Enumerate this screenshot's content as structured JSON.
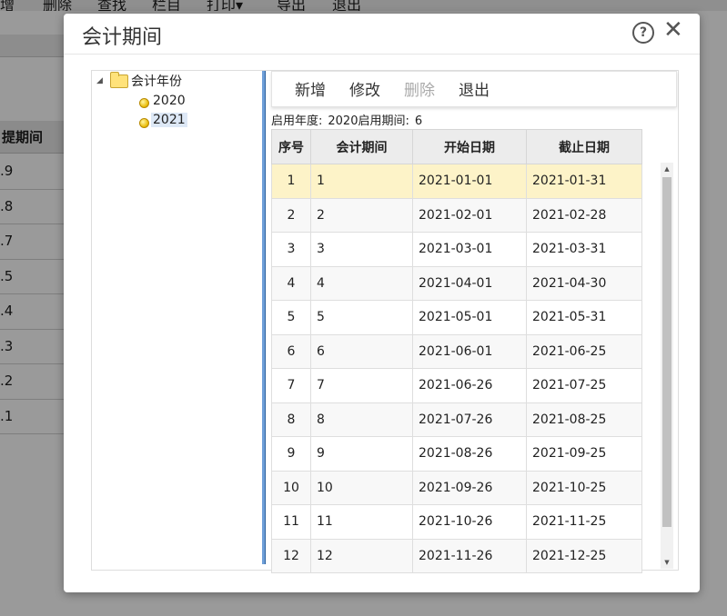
{
  "background": {
    "toolbar_items": [
      "增",
      "删除",
      "查找",
      "栏目",
      "打印▾",
      "导出",
      "退出"
    ],
    "column_header": "提期间",
    "rows": [
      ".9",
      ".8",
      ".7",
      ".5",
      ".4",
      ".3",
      ".2",
      ".1"
    ]
  },
  "dialog": {
    "title": "会计期间",
    "help_symbol": "?",
    "close_symbol": "✕"
  },
  "tree": {
    "root_label": "会计年份",
    "toggle_symbol": "◢",
    "years": [
      "2020",
      "2021"
    ],
    "selected_year": "2021"
  },
  "toolbar": {
    "add_label": "新增",
    "edit_label": "修改",
    "delete_label": "删除",
    "exit_label": "退出"
  },
  "period_info": {
    "start_year_label": "启用年度:",
    "start_year_value": "2020",
    "start_period_label": "启用期间:",
    "start_period_value": "6"
  },
  "table": {
    "headers": [
      "序号",
      "会计期间",
      "开始日期",
      "截止日期"
    ],
    "rows": [
      [
        "1",
        "1",
        "2021-01-01",
        "2021-01-31"
      ],
      [
        "2",
        "2",
        "2021-02-01",
        "2021-02-28"
      ],
      [
        "3",
        "3",
        "2021-03-01",
        "2021-03-31"
      ],
      [
        "4",
        "4",
        "2021-04-01",
        "2021-04-30"
      ],
      [
        "5",
        "5",
        "2021-05-01",
        "2021-05-31"
      ],
      [
        "6",
        "6",
        "2021-06-01",
        "2021-06-25"
      ],
      [
        "7",
        "7",
        "2021-06-26",
        "2021-07-25"
      ],
      [
        "8",
        "8",
        "2021-07-26",
        "2021-08-25"
      ],
      [
        "9",
        "9",
        "2021-08-26",
        "2021-09-25"
      ],
      [
        "10",
        "10",
        "2021-09-26",
        "2021-10-25"
      ],
      [
        "11",
        "11",
        "2021-10-26",
        "2021-11-25"
      ],
      [
        "12",
        "12",
        "2021-11-26",
        "2021-12-25"
      ]
    ]
  },
  "colors": {
    "selected_row": "#fdf3c8",
    "splitter": "#6f9fd8"
  }
}
